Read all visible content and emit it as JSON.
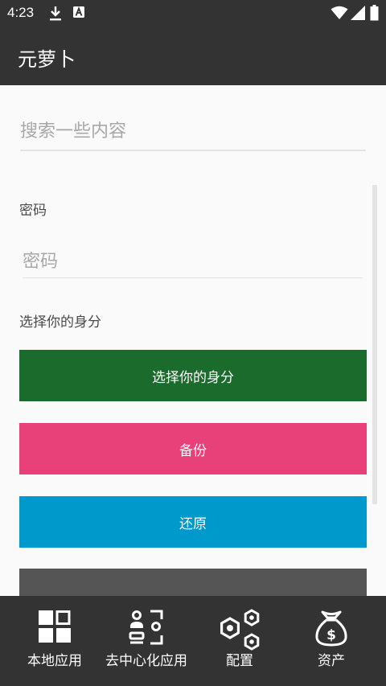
{
  "status_bar": {
    "time": "4:23"
  },
  "app_bar": {
    "title": "元萝卜"
  },
  "search": {
    "placeholder": "搜索一些内容"
  },
  "form": {
    "password_label": "密码",
    "password_placeholder": "密码",
    "identity_label": "选择你的身分"
  },
  "buttons": {
    "identity": "选择你的身分",
    "backup": "备份",
    "restore": "还原"
  },
  "bottom_nav": {
    "items": [
      {
        "label": "本地应用",
        "icon": "grid-icon"
      },
      {
        "label": "去中心化应用",
        "icon": "decentralized-apps-icon"
      },
      {
        "label": "配置",
        "icon": "hexagons-icon"
      },
      {
        "label": "资产",
        "icon": "money-bag-icon"
      }
    ]
  },
  "colors": {
    "bar": "#333333",
    "identity_button": "#1a6b2c",
    "backup_button": "#e8417a",
    "restore_button": "#0099cc"
  }
}
